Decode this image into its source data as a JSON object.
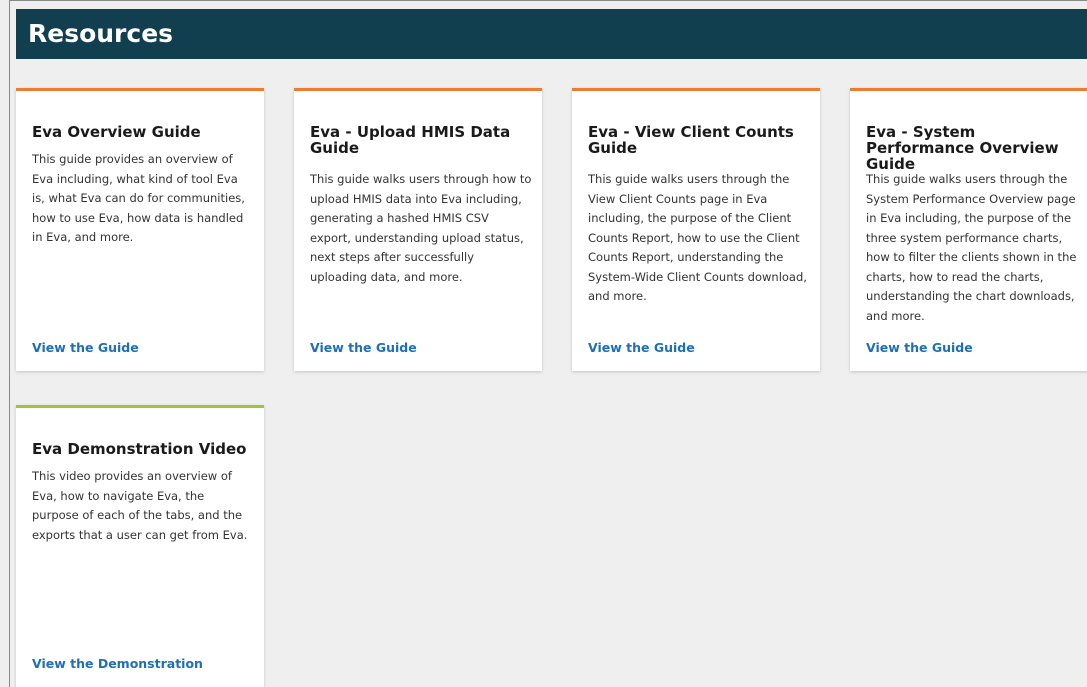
{
  "header": {
    "title": "Resources"
  },
  "colors": {
    "header_bg": "#123f4f",
    "accent_orange": "#ef7b2f",
    "accent_green": "#9ec43a",
    "link": "#1d6fb8"
  },
  "cards": [
    {
      "title": "Eva Overview Guide",
      "description": "This guide provides an overview of Eva including, what kind of tool Eva is, what Eva can do for communities, how to use Eva, how data is handled in Eva, and more.",
      "link": "View the Guide"
    },
    {
      "title": "Eva - Upload HMIS Data Guide",
      "description": "This guide walks users through how to upload HMIS data into Eva including, generating a hashed HMIS CSV export, understanding upload status, next steps after successfully uploading data, and more.",
      "link": "View the Guide"
    },
    {
      "title": "Eva - View Client Counts Guide",
      "description": "This guide walks users through the View Client Counts page in Eva including, the purpose of the Client Counts Report, how to use the Client Counts Report, understanding the System-Wide Client Counts download, and more.",
      "link": "View the Guide"
    },
    {
      "title": "Eva - System Performance Overview Guide",
      "description": "This guide walks users through the System Performance Overview page in Eva including, the purpose of the three system performance charts, how to filter the clients shown in the charts, how to read the charts, understanding the chart downloads, and more.",
      "link": "View the Guide"
    },
    {
      "title": "Eva Demonstration Video",
      "description": "This video provides an overview of Eva, how to navigate Eva, the purpose of each of the tabs, and the exports that a user can get from Eva.",
      "link": "View the Demonstration"
    }
  ]
}
